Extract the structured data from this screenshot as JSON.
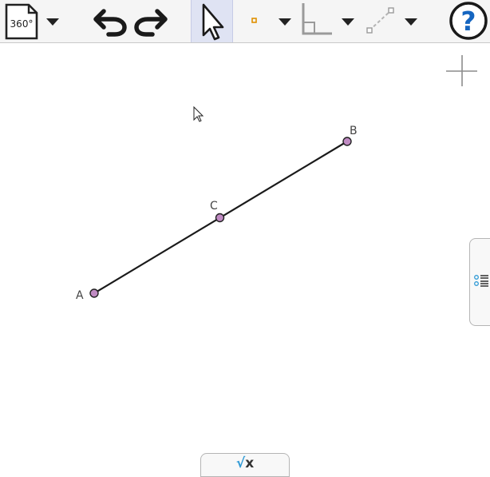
{
  "toolbar": {
    "file_badge": "360°",
    "icons": {
      "file": "file-icon",
      "undo": "undo-icon",
      "redo": "redo-icon",
      "move": "pointer-arrow-icon",
      "point": "point-tool-icon",
      "angle": "angle-tool-icon",
      "line": "line-tool-icon",
      "help": "help-icon"
    },
    "help_label": "?"
  },
  "canvas": {
    "points": [
      {
        "name": "A",
        "label": "A"
      },
      {
        "name": "B",
        "label": "B"
      },
      {
        "name": "C",
        "label": "C"
      }
    ],
    "point_color": "#c08bc3",
    "segment_color": "#1a1a1a"
  },
  "input_bar": {
    "radical": "√",
    "variable": "x"
  },
  "colors": {
    "accent": "#1565c0",
    "selected_tool_bg": "#dfe3f3",
    "point_tool_orange": "#e09000"
  }
}
